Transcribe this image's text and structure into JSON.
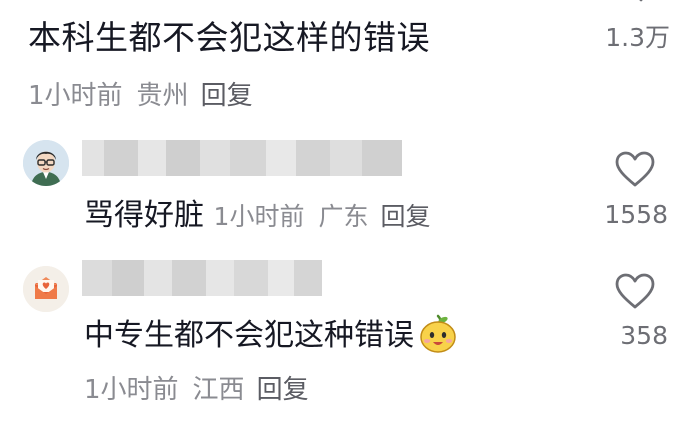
{
  "colors": {
    "text_primary": "#161823",
    "text_secondary": "#8a8b91",
    "reply_link": "#5b5c63",
    "icon_stroke": "#6d6e74"
  },
  "comments": [
    {
      "text": "本科生都不会犯这样的错误",
      "time": "1小时前",
      "location": "贵州",
      "reply_label": "回复",
      "like_count": "1.3万"
    },
    {
      "username": "",
      "text": "骂得好脏",
      "time": "1小时前",
      "location": "广东",
      "reply_label": "回复",
      "like_count": "1558",
      "avatar_icon": "cartoon-man-avatar"
    },
    {
      "username": "",
      "text": "中专生都不会犯这种错误",
      "time": "1小时前",
      "location": "江西",
      "reply_label": "回复",
      "like_count": "358",
      "avatar_icon": "envelope-heart-avatar",
      "emoji_icon": "yellow-face-emoji"
    }
  ]
}
